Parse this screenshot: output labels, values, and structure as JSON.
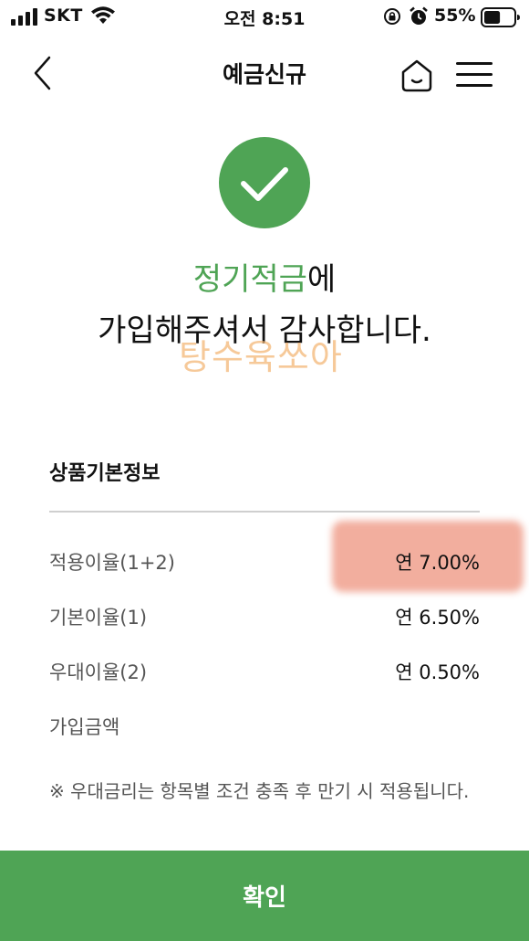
{
  "status_bar": {
    "carrier": "SKT",
    "time": "오전 8:51",
    "battery_percent": "55%",
    "battery_level": 0.55,
    "icons": [
      "signal-icon",
      "wifi-icon",
      "lock-rotation-icon",
      "alarm-icon",
      "battery-icon"
    ]
  },
  "nav": {
    "title": "예금신규",
    "icons": [
      "back-arrow-icon",
      "home-icon",
      "menu-icon"
    ]
  },
  "success": {
    "icon": "check-circle-icon",
    "product_name": "정기적금",
    "line1_suffix": "에",
    "line2": "가입해주셔서 감사합니다.",
    "watermark": "탕수육쏘아"
  },
  "info": {
    "title": "상품기본정보",
    "rows": [
      {
        "label": "적용이율(1+2)",
        "value": "연 7.00%"
      },
      {
        "label": "기본이율(1)",
        "value": "연 6.50%"
      },
      {
        "label": "우대이율(2)",
        "value": "연 0.50%"
      },
      {
        "label": "가입금액",
        "value": ""
      }
    ],
    "note": "※ 우대금리는 항목별 조건 충족 후 만기 시 적용됩니다."
  },
  "footer": {
    "confirm_label": "확인"
  },
  "colors": {
    "accent": "#4fa455",
    "watermark": "#f4b777",
    "highlight": "#ef9a86"
  }
}
